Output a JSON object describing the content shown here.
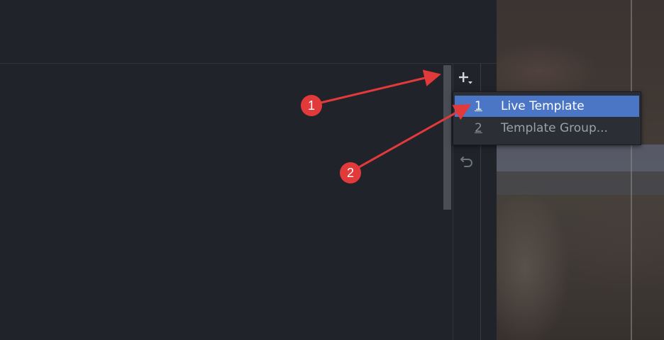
{
  "toolbar": {
    "add_icon": "plus-with-dropdown-icon",
    "revert_icon": "undo-icon"
  },
  "popup_menu": {
    "items": [
      {
        "number": "1",
        "label": "Live Template",
        "selected": true
      },
      {
        "number": "2",
        "label": "Template Group...",
        "selected": false
      }
    ]
  },
  "annotations": {
    "badge_1": "1",
    "badge_2": "2",
    "color": "#e23a3a"
  },
  "colors": {
    "background": "#21232b",
    "selection": "#4b76c6",
    "menu_background": "#2b2e35"
  }
}
